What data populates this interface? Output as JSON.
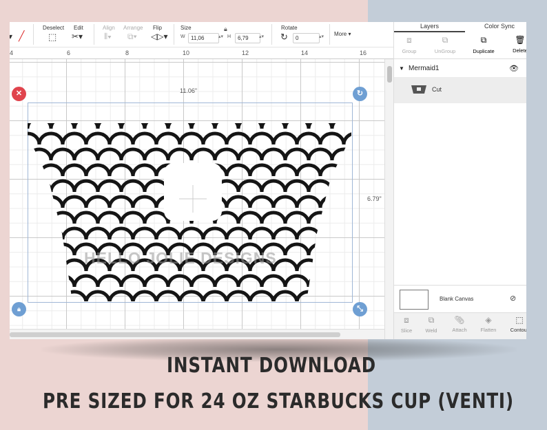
{
  "toolbar": {
    "deselect": "Deselect",
    "edit": "Edit",
    "align": "Align",
    "arrange": "Arrange",
    "flip": "Flip",
    "size": "Size",
    "width_label": "W",
    "width_value": "11,06",
    "height_label": "H",
    "height_value": "6,79",
    "rotate": "Rotate",
    "rotate_value": "0",
    "more": "More"
  },
  "ruler": [
    "4",
    "6",
    "8",
    "10",
    "12",
    "14",
    "16"
  ],
  "canvas": {
    "width_dim": "11.06\"",
    "height_dim": "6.79\"",
    "watermark": "HELLO JOLIE DESIGNS"
  },
  "panel": {
    "tab_layers": "Layers",
    "tab_color_sync": "Color Sync",
    "actions": {
      "group": "Group",
      "ungroup": "UnGroup",
      "duplicate": "Duplicate",
      "delete": "Delete"
    },
    "layer_name": "Mermaid1",
    "layer_op": "Cut",
    "blank_canvas": "Blank Canvas",
    "bottom": {
      "slice": "Slice",
      "weld": "Weld",
      "attach": "Attach",
      "flatten": "Flatten",
      "contour": "Contour"
    }
  },
  "captions": {
    "line1": "INSTANT DOWNLOAD",
    "line2": "PRE SIZED FOR 24 OZ STARBUCKS CUP (VENTI)"
  },
  "colors": {
    "bg_left": "#ecd5d2",
    "bg_right": "#c3cdd8",
    "accent_red": "#e0444d",
    "accent_blue": "#6f9fd3"
  }
}
